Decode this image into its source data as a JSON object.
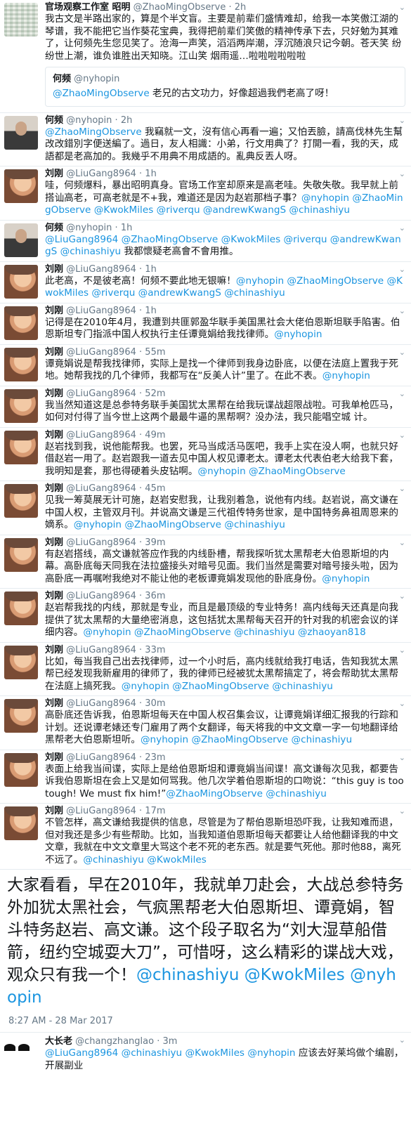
{
  "tweets": [
    {
      "avatar": "observe",
      "name": "官场观察工作室 昭明",
      "handle": "@ZhaoMingObserve",
      "time": "2h",
      "segments": [
        {
          "t": "我古文是半路出家的，算是个半文盲。主要是前辈们盛情难却，给我一本笑傲江湖的琴谱，我不能把它当作葵花宝典，我得把前辈们笑傲的精神传承下去，只好勉为其难了，让何频先生您见笑了。沧海一声笑，滔滔两岸潮，浮沉随浪只记今朝。苍天笑 纷纷世上潮，谁负谁胜出天知晓。江山笑 烟雨遥…啦啦啦啦啦啦"
        }
      ],
      "quote": {
        "name": "何频",
        "handle": "@nyhopin",
        "segments": [
          {
            "t": "@ZhaoMingObserve",
            "m": true
          },
          {
            "t": " 老兄的古文功力，好像超過我們老高了呀！"
          }
        ]
      }
    },
    {
      "avatar": "he",
      "name": "何频",
      "handle": "@nyhopin",
      "time": "2h",
      "segments": [
        {
          "t": "@ZhaoMingObserve",
          "m": true
        },
        {
          "t": " 我竊就一文，沒有信心再看一遍；又怕丟臉，請高伐林先生幫改改錯別字便送編了。過日，友人相識：小弟，行文用典了？打開一看，我的天，成語都是老高加的。我幾乎不用典不用成語的。亂典反丟人呀。"
        }
      ]
    },
    {
      "avatar": "liu",
      "name": "刘刚",
      "handle": "@LiuGang8964",
      "time": "1h",
      "segments": [
        {
          "t": "哇，何频爆料，暴出昭明真身。官场工作室却原来是高老哇。失敬失敬。我早就上前搭讪高老，可高老就是不+我，难道还是因为赵岩那档子事？"
        },
        {
          "t": "@nyhopin",
          "m": true
        },
        {
          "t": " "
        },
        {
          "t": "@ZhaoMingObserve",
          "m": true
        },
        {
          "t": " "
        },
        {
          "t": "@KwokMiles",
          "m": true
        },
        {
          "t": " "
        },
        {
          "t": "@riverqu",
          "m": true
        },
        {
          "t": " "
        },
        {
          "t": "@andrewKwangS",
          "m": true
        },
        {
          "t": " "
        },
        {
          "t": "@chinashiyu",
          "m": true
        }
      ]
    },
    {
      "avatar": "he",
      "name": "何频",
      "handle": "@nyhopin",
      "time": "1h",
      "segments": [
        {
          "t": "@LiuGang8964",
          "m": true
        },
        {
          "t": " "
        },
        {
          "t": "@ZhaoMingObserve",
          "m": true
        },
        {
          "t": " "
        },
        {
          "t": "@KwokMiles",
          "m": true
        },
        {
          "t": " "
        },
        {
          "t": "@riverqu",
          "m": true
        },
        {
          "t": " "
        },
        {
          "t": "@andrewKwangS",
          "m": true
        },
        {
          "t": " "
        },
        {
          "t": "@chinashiyu",
          "m": true
        },
        {
          "t": " 我都懷疑老高會不會用推。"
        }
      ]
    },
    {
      "avatar": "liu",
      "name": "刘刚",
      "handle": "@LiuGang8964",
      "time": "1h",
      "segments": [
        {
          "t": "此老高，不是彼老高！何频不要此地无银嘛！"
        },
        {
          "t": "@nyhopin",
          "m": true
        },
        {
          "t": " "
        },
        {
          "t": "@ZhaoMingObserve",
          "m": true
        },
        {
          "t": " "
        },
        {
          "t": "@KwokMiles",
          "m": true
        },
        {
          "t": " "
        },
        {
          "t": "@riverqu",
          "m": true
        },
        {
          "t": " "
        },
        {
          "t": "@andrewKwangS",
          "m": true
        },
        {
          "t": " "
        },
        {
          "t": "@chinashiyu",
          "m": true
        }
      ]
    },
    {
      "avatar": "liu",
      "name": "刘刚",
      "handle": "@LiuGang8964",
      "time": "1h",
      "segments": [
        {
          "t": "记得是在2010年4月，我遭到共匪郭盈华联手美国黑社会大佬伯恩斯坦联手陷害。伯恩斯坦专门指派中国人权执行主任谭竟娟给我找律师。"
        },
        {
          "t": "@nyhopin",
          "m": true
        }
      ]
    },
    {
      "avatar": "liu",
      "name": "刘刚",
      "handle": "@LiuGang8964",
      "time": "55m",
      "segments": [
        {
          "t": "谭竟娟说是帮我找律师，实际上是找一个律师到我身边卧底，以便在法庭上置我于死地。她帮我找的几个律师，我都写在“反美人计”里了。在此不表。"
        },
        {
          "t": "@nyhopin",
          "m": true
        }
      ]
    },
    {
      "avatar": "liu",
      "name": "刘刚",
      "handle": "@LiuGang8964",
      "time": "52m",
      "segments": [
        {
          "t": "我当然知道这是总参特务联手美国犹太黑帮在给我玩谍战超限战啦。可我单枪匹马，如何对付得了当今世上这两个最最牛逼的黑帮啊？没办法，我只能唱空城 计。"
        }
      ]
    },
    {
      "avatar": "liu",
      "name": "刘刚",
      "handle": "@LiuGang8964",
      "time": "49m",
      "segments": [
        {
          "t": "赵岩找到我，说他能帮我。也罢，死马当成活马医吧，我手上实在没人啊，也就只好借赵岩一用了。赵岩跟我一道去见中国人权见谭老太。谭老太代表伯老大给我下套，我明知是套，那也得硬着头皮钻啊。"
        },
        {
          "t": "@nyhopin",
          "m": true
        },
        {
          "t": " "
        },
        {
          "t": "@ZhaoMingObserve",
          "m": true
        }
      ]
    },
    {
      "avatar": "liu",
      "name": "刘刚",
      "handle": "@LiuGang8964",
      "time": "45m",
      "segments": [
        {
          "t": "见我一筹莫展无计可施，赵岩安慰我，让我别着急，说他有内线。赵岩说，高文谦在中国人权，主管双月刊。并说高文谦是三代祖传特务世家，是中国特务鼻祖周恩来的嫡系。"
        },
        {
          "t": "@nyhopin",
          "m": true
        },
        {
          "t": " "
        },
        {
          "t": "@ZhaoMingObserve",
          "m": true
        },
        {
          "t": " "
        },
        {
          "t": "@chinashiyu",
          "m": true
        }
      ]
    },
    {
      "avatar": "liu",
      "name": "刘刚",
      "handle": "@LiuGang8964",
      "time": "39m",
      "segments": [
        {
          "t": "有赵岩搭线，高文谦就答应作我的内线卧槽，帮我探听犹太黑帮老大伯恩斯坦的内幕。高卧底每天同我在法拉盛接头对暗号见面。我们当然是需要对暗号接头啦，因为高卧底一再嘱咐我绝对不能让他的老板谭竟娟发现他的卧底身份。"
        },
        {
          "t": "@nyhopin",
          "m": true
        }
      ]
    },
    {
      "avatar": "liu",
      "name": "刘刚",
      "handle": "@LiuGang8964",
      "time": "36m",
      "segments": [
        {
          "t": "赵岩帮我找的内线，那就是专业，而且是最顶级的专业特务！高内线每天还真是向我提供了犹太黑帮的大量绝密消息，这包括犹太黑帮每天召开的针对我的机密会议的详细内容。"
        },
        {
          "t": "@nyhopin",
          "m": true
        },
        {
          "t": " "
        },
        {
          "t": "@ZhaoMingObserve",
          "m": true
        },
        {
          "t": " "
        },
        {
          "t": "@chinashiyu",
          "m": true
        },
        {
          "t": " "
        },
        {
          "t": "@zhaoyan818",
          "m": true
        }
      ]
    },
    {
      "avatar": "liu",
      "name": "刘刚",
      "handle": "@LiuGang8964",
      "time": "33m",
      "segments": [
        {
          "t": "比如，每当我自己出去找律师，过一个小时后，高内线就给我打电话，告知我犹太黑帮已经发现我新雇用的律师了，我的律师已经被犹太黑帮搞定了，将会帮助犹太黑帮在法庭上搞死我。"
        },
        {
          "t": "@nyhopin",
          "m": true
        },
        {
          "t": " "
        },
        {
          "t": "@ZhaoMingObserve",
          "m": true
        },
        {
          "t": " "
        },
        {
          "t": "@chinashiyu",
          "m": true
        }
      ]
    },
    {
      "avatar": "liu",
      "name": "刘刚",
      "handle": "@LiuGang8964",
      "time": "30m",
      "segments": [
        {
          "t": "高卧底还告诉我，伯恩斯坦每天在中国人权召集会议，让谭竟娟详细汇报我的行踪和计划。还说谭老婊还专门雇用了两个女翻译，每天将我的中文文章一字一句地翻译给黑帮老大伯恩斯坦听。"
        },
        {
          "t": "@nyhopin",
          "m": true
        },
        {
          "t": " "
        },
        {
          "t": "@ZhaoMingObserve",
          "m": true
        },
        {
          "t": " "
        },
        {
          "t": "@chinashiyu",
          "m": true
        }
      ]
    },
    {
      "avatar": "liu",
      "name": "刘刚",
      "handle": "@LiuGang8964",
      "time": "23m",
      "segments": [
        {
          "t": "表面上给我当间谍，实际上是给伯恩斯坦和谭竟娟当间谍！高文谦每次见我，都要告诉我伯恩斯坦在会上又是如何骂我。他几次学着伯恩斯坦的口吻说：“this guy is too tough! We must fix him!”"
        },
        {
          "t": "@ZhaoMingObserve",
          "m": true
        },
        {
          "t": " "
        },
        {
          "t": "@chinashiyu",
          "m": true
        }
      ]
    },
    {
      "avatar": "liu",
      "name": "刘刚",
      "handle": "@LiuGang8964",
      "time": "17m",
      "segments": [
        {
          "t": "不管怎样，高文谦给我提供的信息，尽管是为了帮伯恩斯坦恐吓我，让我知难而退，但对我还是多少有些帮助。比如，当我知道伯恩斯坦每天都要让人给他翻译我的中文文章，我就在中文文章里大骂这个老不死的老东西。就是要气死他。那时他88，离死不远了。"
        },
        {
          "t": "@chinashiyu",
          "m": true
        },
        {
          "t": " "
        },
        {
          "t": "@KwokMiles",
          "m": true
        }
      ]
    }
  ],
  "main_tweet": {
    "segments": [
      {
        "t": "大家看看，早在2010年，我就单刀赴会，大战总参特务外加犹太黑社会，气疯黑帮老大伯恩斯坦、谭竟娟，智斗特务赵岩、高文谦。这个段子取名为“刘大湿草船借箭，纽约空城耍大刀”，可惜呀，这么精彩的谍战大戏，观众只有我一个！"
      },
      {
        "t": "@chinashiyu",
        "m": true
      },
      {
        "t": " "
      },
      {
        "t": "@KwokMiles",
        "m": true
      },
      {
        "t": " "
      },
      {
        "t": "@nyhopin",
        "m": true
      }
    ],
    "timestamp": "8:27 AM - 28 Mar 2017"
  },
  "reply": {
    "avatar": "big",
    "name": "大长老",
    "handle": "@changzhanglao",
    "time": "3m",
    "segments": [
      {
        "t": "@LiuGang8964",
        "m": true
      },
      {
        "t": " "
      },
      {
        "t": "@chinashiyu",
        "m": true
      },
      {
        "t": " "
      },
      {
        "t": "@KwokMiles",
        "m": true
      },
      {
        "t": " "
      },
      {
        "t": "@nyhopin",
        "m": true
      },
      {
        "t": " 应该去好莱坞做个编剧，开展副业"
      }
    ]
  },
  "ui": {
    "dot": "·",
    "caret": "⌄"
  }
}
